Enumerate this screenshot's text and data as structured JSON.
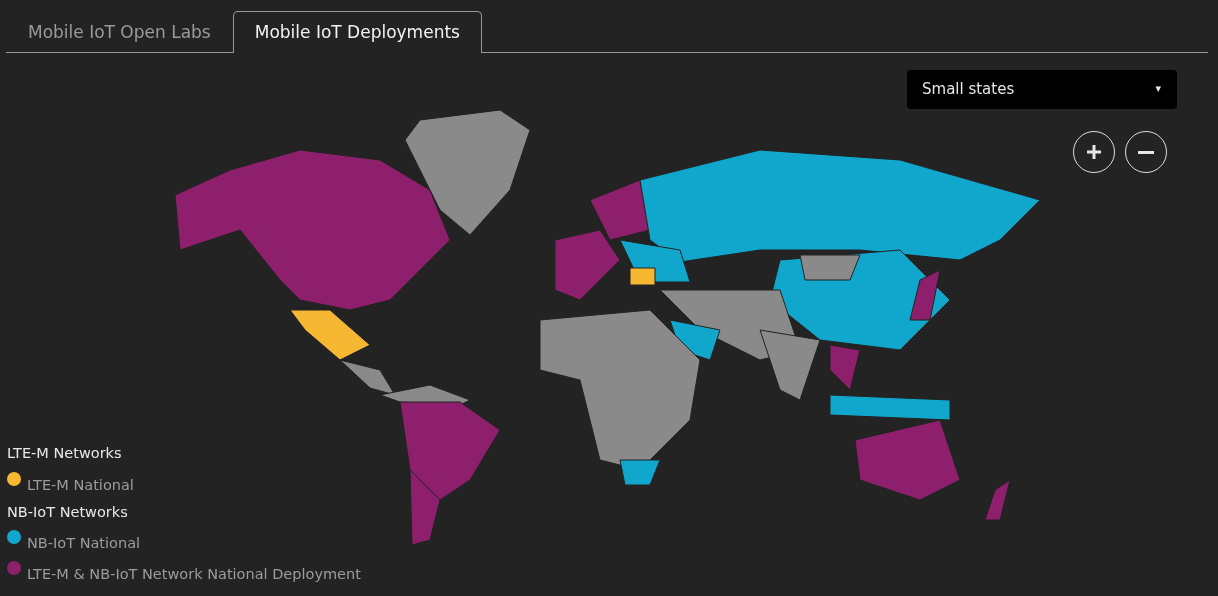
{
  "tabs": [
    {
      "label": "Mobile IoT Open Labs",
      "selected": false
    },
    {
      "label": "Mobile IoT Deployments",
      "selected": true
    }
  ],
  "region_select": {
    "value": "Small states",
    "caret": "▾"
  },
  "zoom_controls": [
    {
      "kind": "zoom-in"
    },
    {
      "kind": "zoom-out"
    }
  ],
  "legend": {
    "groups": [
      {
        "title": "LTE-M Networks",
        "items": [
          {
            "label": "LTE-M National",
            "color": "#f6b732"
          }
        ]
      },
      {
        "title": "NB-IoT Networks",
        "items": [
          {
            "label": "NB-IoT National",
            "color": "#11a6cc"
          },
          {
            "label": "LTE-M & NB-IoT Network National Deployment",
            "color": "#8e1f6c"
          }
        ]
      }
    ]
  }
}
